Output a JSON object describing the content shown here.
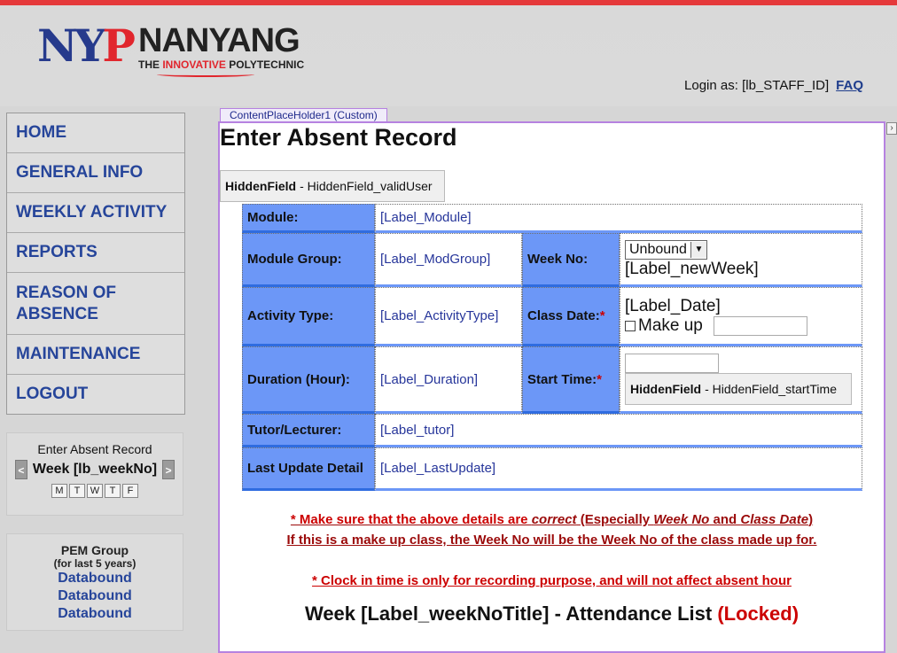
{
  "header": {
    "logo_mark_n": "N",
    "logo_mark_y": "Y",
    "logo_mark_p": "P",
    "logo_name": "NANYANG",
    "logo_tag_pre": "THE",
    "logo_tag_highlight": "INNOVATIVE",
    "logo_tag_post": "POLYTECHNIC",
    "login_label": "Login as: [lb_STAFF_ID]",
    "faq_label": "FAQ"
  },
  "nav": {
    "items": [
      {
        "label": "HOME"
      },
      {
        "label": "GENERAL INFO"
      },
      {
        "label": "WEEKLY ACTIVITY"
      },
      {
        "label": "REPORTS"
      },
      {
        "label": "REASON OF ABSENCE"
      },
      {
        "label": "MAINTENANCE"
      },
      {
        "label": "LOGOUT"
      }
    ]
  },
  "week_box": {
    "title": "Enter Absent Record",
    "prev": "<",
    "week_label": "Week [lb_weekNo]",
    "next": ">",
    "days": [
      "M",
      "T",
      "W",
      "T",
      "F"
    ]
  },
  "pem_box": {
    "title": "PEM Group",
    "subtitle": "(for last 5 years)",
    "links": [
      "Databound",
      "Databound",
      "Databound"
    ]
  },
  "content": {
    "placeholder_tag": "ContentPlaceHolder1 (Custom)",
    "scroll_glyph": "›",
    "page_title": "Enter Absent Record",
    "hidden_valid_user_type": "HiddenField",
    "hidden_valid_user_name": "- HiddenField_validUser",
    "form": {
      "module_label": "Module:",
      "module_value": "[Label_Module]",
      "modgroup_label": "Module Group:",
      "modgroup_value": "[Label_ModGroup]",
      "weekno_label": "Week No:",
      "weekno_select": "Unbound",
      "weekno_value": "[Label_newWeek]",
      "activity_label": "Activity Type:",
      "activity_value": "[Label_ActivityType]",
      "classdate_label": "Class Date:",
      "required_mark": "*",
      "classdate_value": "[Label_Date]",
      "makeup_label": "Make up",
      "duration_label": "Duration (Hour):",
      "duration_value": "[Label_Duration]",
      "starttime_label": "Start Time:",
      "hidden_start_type": "HiddenField",
      "hidden_start_name": "- HiddenField_startTime",
      "tutor_label": "Tutor/Lecturer:",
      "tutor_value": "[Label_tutor]",
      "lastupdate_label": "Last Update Detail",
      "lastupdate_value": "[Label_LastUpdate]"
    },
    "notes": {
      "line1_a": "* Make sure that the above details are ",
      "line1_b": "correct",
      "line1_c": " (Especially ",
      "line1_d": "Week No",
      "line1_e": " and ",
      "line1_f": "Class Date",
      "line1_g": ")",
      "line2": "If this is a make up class, the Week No will be the Week No of the class made up for.",
      "line3": "* Clock in time is only for recording purpose, and will not affect absent hour"
    },
    "attendance_title": "Week [Label_weekNoTitle] - Attendance List",
    "attendance_locked": "(Locked)"
  },
  "colors": {
    "label_blue": "#6c97f7",
    "nav_text": "#26459a",
    "notes_red": "#9b0a0a",
    "locked_red": "#cc0000",
    "placeholder_border": "#b682e0"
  }
}
